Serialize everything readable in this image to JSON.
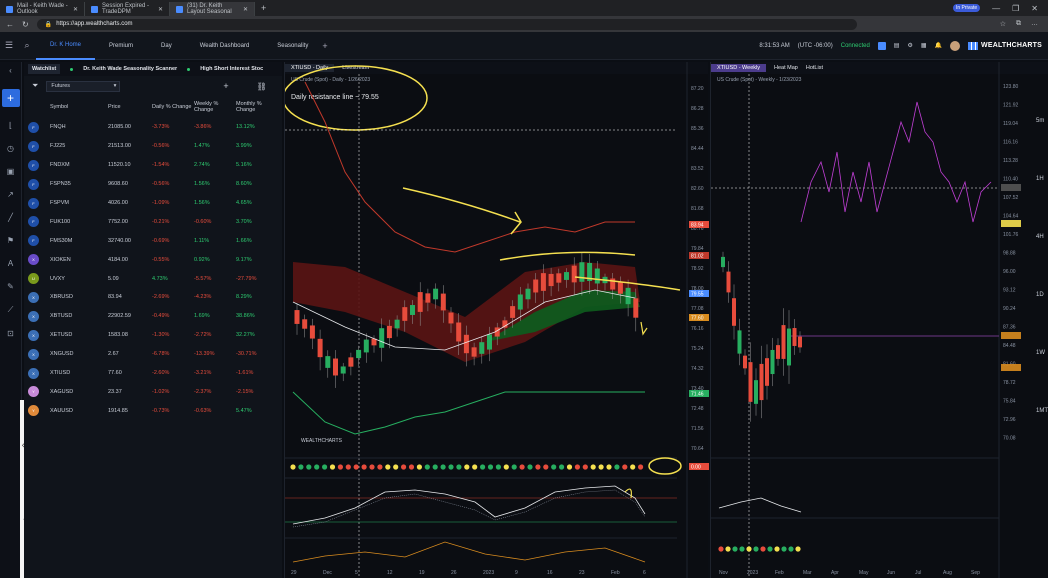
{
  "browser": {
    "tabs": [
      {
        "label": "Mail - Keith Wade - Outlook"
      },
      {
        "label": "Session Expired - TradeDPM"
      },
      {
        "label": "(31) Dr. Keith Layout Seasonal"
      }
    ],
    "url": "https://app.wealthcharts.com",
    "inprivate": "In Private"
  },
  "app": {
    "tabs": [
      "Dr. K Home",
      "Premium",
      "Day",
      "Wealth Dashboard",
      "Seasonality"
    ],
    "time": "8:31:53 AM",
    "timezone": "(UTC -06:00)",
    "status": "Connected",
    "brand": "WEALTHCHARTS"
  },
  "watchlist": {
    "tabs": [
      "Watchlist",
      "Dr. Keith Wade Seasonality Scanner",
      "High Short Interest Stoc"
    ],
    "filter": "Futures",
    "columns": {
      "symbol": "Symbol",
      "price": "Price",
      "daily": "Daily % Change",
      "weekly": "Weekly % Change",
      "monthly": "Monthly % Change"
    },
    "rows": [
      {
        "sym": "FNQH",
        "price": "21085.00",
        "d": "-3.73%",
        "w": "-3.86%",
        "m": "13.12%",
        "ic": "#1f4fa8",
        "t": "F"
      },
      {
        "sym": "FJ225",
        "price": "21513.00",
        "d": "-0.56%",
        "w": "1.47%",
        "m": "3.99%",
        "ic": "#1f4fa8",
        "t": "F"
      },
      {
        "sym": "FNDXM",
        "price": "11520.10",
        "d": "-1.54%",
        "w": "2.74%",
        "m": "5.16%",
        "ic": "#1f4fa8",
        "t": "F"
      },
      {
        "sym": "FSPN35",
        "price": "9608.60",
        "d": "-0.56%",
        "w": "1.56%",
        "m": "8.60%",
        "ic": "#1f4fa8",
        "t": "F"
      },
      {
        "sym": "FSPVM",
        "price": "4026.00",
        "d": "-1.09%",
        "w": "1.56%",
        "m": "4.65%",
        "ic": "#1f4fa8",
        "t": "F"
      },
      {
        "sym": "FUK100",
        "price": "7752.00",
        "d": "-0.21%",
        "w": "-0.60%",
        "m": "3.70%",
        "ic": "#1f4fa8",
        "t": "F"
      },
      {
        "sym": "FMS30M",
        "price": "32740.00",
        "d": "-0.69%",
        "w": "1.11%",
        "m": "1.66%",
        "ic": "#1f4fa8",
        "t": "F"
      },
      {
        "sym": "XIOKEN",
        "price": "4184.00",
        "d": "-0.55%",
        "w": "0.92%",
        "m": "9.17%",
        "ic": "#6a4cc9",
        "t": "X"
      },
      {
        "sym": "UVXY",
        "price": "5.09",
        "d": "4.73%",
        "w": "-5.57%",
        "m": "-27.79%",
        "ic": "#7a9a1c",
        "t": "U"
      },
      {
        "sym": "XBRUSD",
        "price": "83.94",
        "d": "-2.69%",
        "w": "-4.23%",
        "m": "8.29%",
        "ic": "#3b6fb5",
        "t": "X"
      },
      {
        "sym": "XBTUSD",
        "price": "22902.59",
        "d": "-0.49%",
        "w": "1.69%",
        "m": "38.86%",
        "ic": "#3b6fb5",
        "t": "X"
      },
      {
        "sym": "XETUSD",
        "price": "1583.08",
        "d": "-1.30%",
        "w": "-2.72%",
        "m": "32.27%",
        "ic": "#3b6fb5",
        "t": "X"
      },
      {
        "sym": "XNGUSD",
        "price": "2.67",
        "d": "-6.78%",
        "w": "-13.39%",
        "m": "-30.71%",
        "ic": "#3b6fb5",
        "t": "X"
      },
      {
        "sym": "XTIUSD",
        "price": "77.60",
        "d": "-2.60%",
        "w": "-3.21%",
        "m": "-1.61%",
        "ic": "#3b6fb5",
        "t": "X"
      },
      {
        "sym": "XAGUSD",
        "price": "23.37",
        "d": "-1.02%",
        "w": "-2.37%",
        "m": "-2.15%",
        "ic": "#c88bd9",
        "t": "Y"
      },
      {
        "sym": "XAUUSD",
        "price": "1914.85",
        "d": "-0.73%",
        "w": "-0.63%",
        "m": "5.47%",
        "ic": "#e08a3a",
        "t": "Y"
      }
    ]
  },
  "chartA": {
    "tabs": [
      "XTIUSD - Daily",
      "Livestream"
    ],
    "legend": "US Crude (Spot) - Daily - 1/26/2023",
    "annotation": "Daily resistance line ~ 79.55",
    "axis": [
      "87.20",
      "86.28",
      "85.36",
      "84.44",
      "83.52",
      "82.60",
      "81.68",
      "80.76",
      "79.84",
      "78.92",
      "78.00",
      "77.08",
      "76.16",
      "75.24",
      "74.32",
      "73.40",
      "72.48",
      "71.56",
      "70.64"
    ],
    "tags": [
      {
        "v": "83.94",
        "c": "#e74c3c"
      },
      {
        "v": "81.02",
        "c": "#c0392b"
      },
      {
        "v": "79.55",
        "c": "#4a8cff"
      },
      {
        "v": "77.60",
        "c": "#d98c1f"
      },
      {
        "v": "71.46",
        "c": "#27ae60"
      },
      {
        "v": "0.00",
        "c": "#e74c3c"
      }
    ],
    "xlabels": [
      "29",
      "Dec",
      "5",
      "12",
      "19",
      "26",
      "2023",
      "9",
      "16",
      "23",
      "Feb",
      "6"
    ],
    "brand": "WEALTHCHARTS"
  },
  "chartB": {
    "tabs": [
      "XTIUSD - Weekly",
      "Heat Map",
      "HotList"
    ],
    "legend": "US Crude (Spot) - Weekly - 1/23/2023",
    "axis": [
      "123.80",
      "121.92",
      "119.04",
      "116.16",
      "113.28",
      "110.40",
      "107.52",
      "104.64",
      "101.76",
      "98.88",
      "96.00",
      "93.12",
      "90.24",
      "87.36",
      "84.48",
      "81.60",
      "78.72",
      "75.84",
      "72.96",
      "70.08"
    ],
    "periods": [
      "5m",
      "1H",
      "4H",
      "1D",
      "1W",
      "1MTH"
    ],
    "xlabels": [
      "Nov",
      "2023",
      "Feb",
      "Mar",
      "Apr",
      "May",
      "Jun",
      "Jul",
      "Aug",
      "Sep"
    ]
  }
}
